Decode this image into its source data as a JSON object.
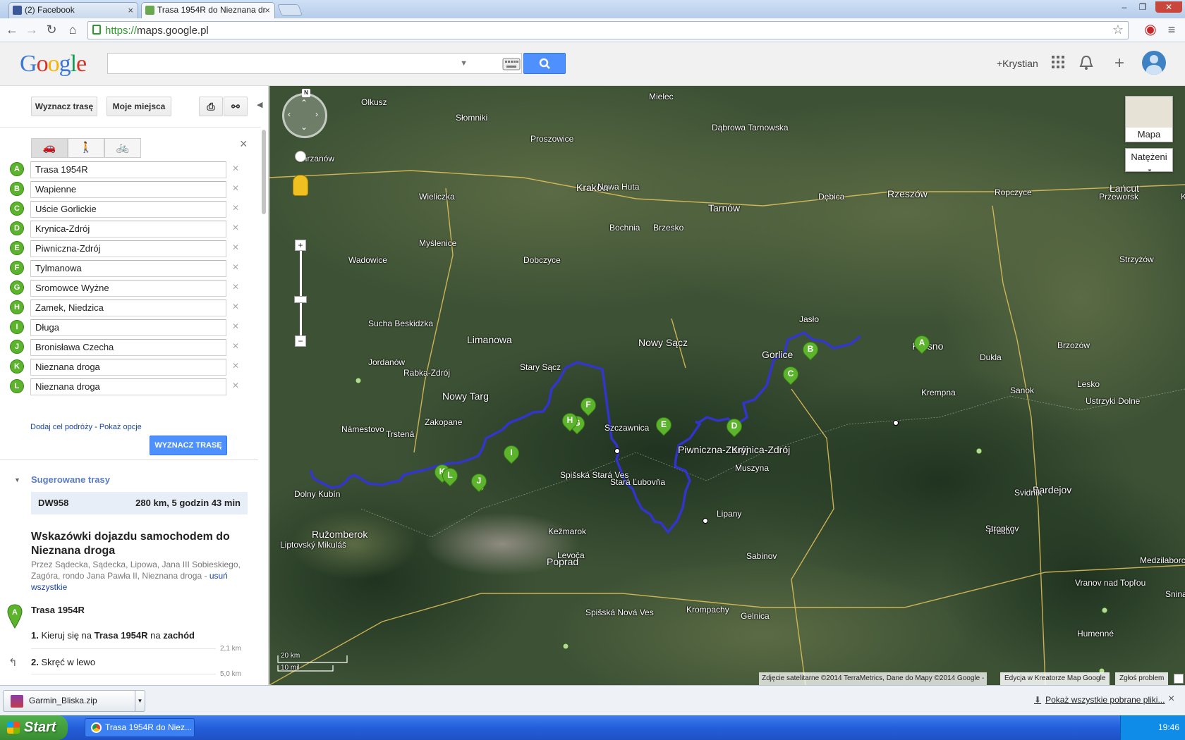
{
  "browser": {
    "tabs": [
      {
        "title": "(2) Facebook",
        "active": false
      },
      {
        "title": "Trasa 1954R do Nieznana dr",
        "active": true
      }
    ],
    "url_proto": "https://",
    "url_host": "maps.google.pl"
  },
  "gbar": {
    "logo": "Google",
    "user": "+Krystian"
  },
  "panel": {
    "directions_button": "Wyznacz trasę",
    "my_places_button": "Moje miejsca",
    "waypoints": [
      {
        "letter": "A",
        "value": "Trasa 1954R"
      },
      {
        "letter": "B",
        "value": "Wapienne"
      },
      {
        "letter": "C",
        "value": "Uście Gorlickie"
      },
      {
        "letter": "D",
        "value": "Krynica-Zdrój"
      },
      {
        "letter": "E",
        "value": "Piwniczna-Zdrój"
      },
      {
        "letter": "F",
        "value": "Tylmanowa"
      },
      {
        "letter": "G",
        "value": "Sromowce Wyżne"
      },
      {
        "letter": "H",
        "value": "Zamek, Niedzica"
      },
      {
        "letter": "I",
        "value": "Długa"
      },
      {
        "letter": "J",
        "value": "Bronisława Czecha"
      },
      {
        "letter": "K",
        "value": "Nieznana droga"
      },
      {
        "letter": "L",
        "value": "Nieznana droga"
      }
    ],
    "add_destination": "Dodaj cel podróży",
    "show_options": "Pokaż opcje",
    "route_button": "WYZNACZ TRASĘ",
    "suggested_title": "Sugerowane trasy",
    "suggested_route": {
      "name": "DW958",
      "summary": "280 km, 5 godzin 43 min"
    },
    "directions_title": "Wskazówki dojazdu samochodem do Nieznana droga",
    "via": "Przez Sądecka, Sądecka, Lipowa, Jana III Sobieskiego, Zagóra, rondo Jana Pawła II, Nieznana droga -",
    "remove_all": "usuń wszystkie",
    "start_label": "Trasa 1954R",
    "steps": [
      {
        "num": "1.",
        "pre": "Kieruj się na ",
        "bold": "Trasa 1954R",
        "mid": " na ",
        "bold2": "zachód",
        "dist": "2,1 km"
      },
      {
        "num": "2.",
        "pre": "Skręć w lewo",
        "bold": "",
        "mid": "",
        "bold2": "",
        "dist": "5,0 km"
      }
    ]
  },
  "map": {
    "type_button": "Mapa",
    "traffic_button": "Natężeni",
    "scale_km": "20 km",
    "scale_mi": "10 mil",
    "attribution": "Zdjęcie satelitarne ©2014 TerraMetrics, Dane do Mapy ©2014 Google -",
    "edit_link": "Edycja w Kreatorze Map Google",
    "report_link": "Zgłoś problem",
    "labels": [
      "Kraków",
      "Nowa Huta",
      "Tarnów",
      "Dębica",
      "Rzeszów",
      "Mielec",
      "Nowy Sącz",
      "Stary Sącz",
      "Gorlice",
      "Krosno",
      "Sanok",
      "Nowy Targ",
      "Zakopane",
      "Szczawnica",
      "Piwniczna-Zdrój",
      "Krynica-Zdrój",
      "Muszyna",
      "Bardejov",
      "Prešov",
      "Poprad",
      "Ružomberok",
      "Liptovský Mikuláš",
      "Dolny Kubín",
      "Humenné",
      "Limanowa",
      "Bochnia",
      "Brzesko",
      "Wieliczka",
      "Myślenice",
      "Rabka-Zdrój",
      "Jasło",
      "Dukla",
      "Krempna",
      "Kežmarok",
      "Stará Ľubovňa",
      "Svidník",
      "Stropkov",
      "Jordanów",
      "Sucha Beskidzka",
      "Wadowice",
      "Chrzanów",
      "Olkusz",
      "Słomniki",
      "Proszowice",
      "Dąbrowa Tarnowska",
      "Ropczyce",
      "Łańcut",
      "Przeworsk",
      "Strzyżów",
      "Brzozów",
      "Lesko",
      "Ustrzyki Dolne",
      "Trstená",
      "Námestovo",
      "Spišská Stará Ves",
      "Levoča",
      "Spišská Nová Ves",
      "Sabinov",
      "Lipany",
      "Gelnica",
      "Krompachy",
      "Medzilaborce",
      "Snina",
      "Vranov nad Topľou",
      "Krosno",
      "Dobczyce"
    ]
  },
  "downloads": {
    "file": "Garmin_Bliska.zip",
    "show_all": "Pokaż wszystkie pobrane pliki..."
  },
  "taskbar": {
    "start": "Start",
    "window": "Trasa 1954R do Niez...",
    "time": "19:46"
  }
}
